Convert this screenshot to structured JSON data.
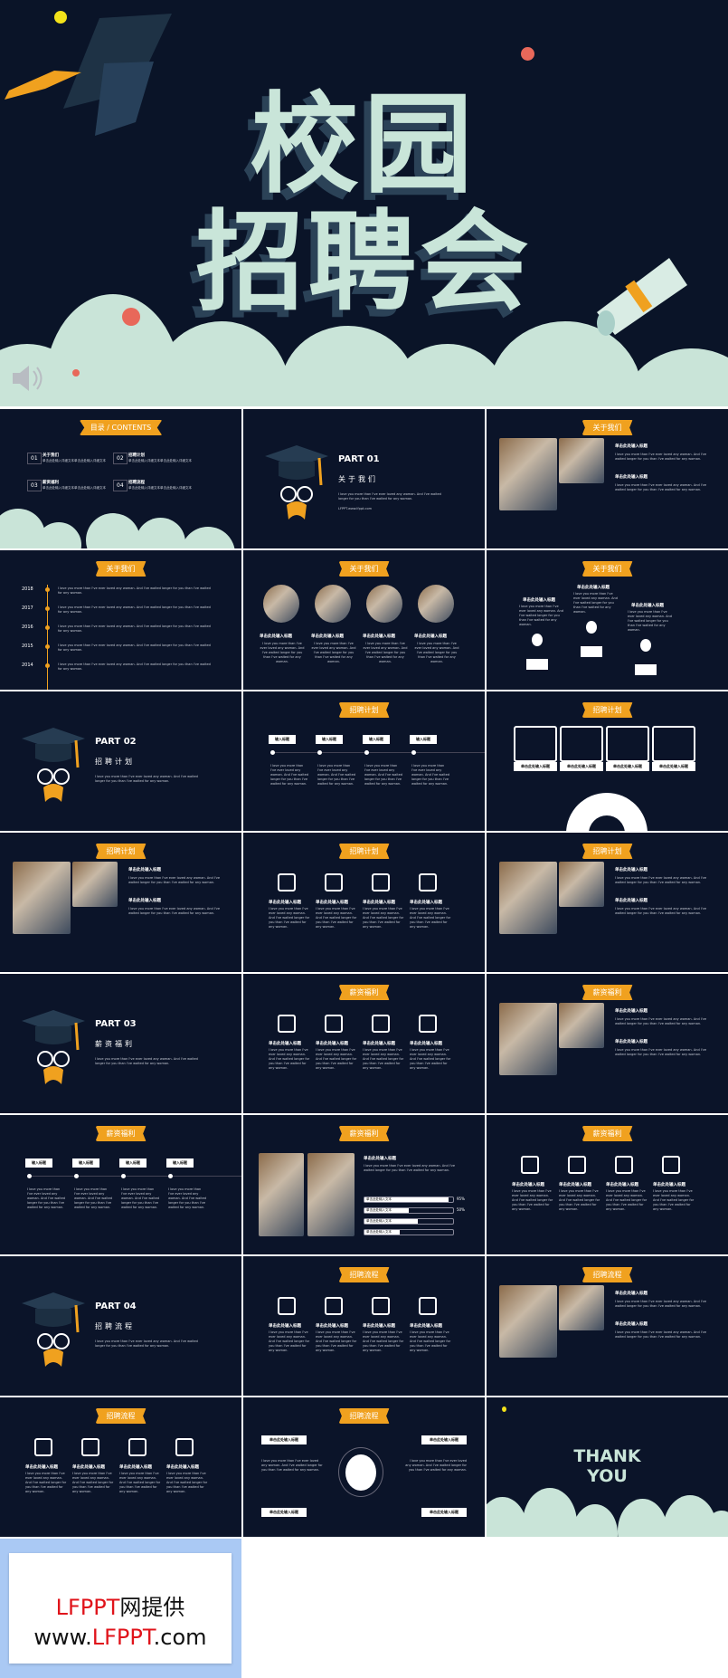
{
  "hero": {
    "title_line1": "校园",
    "title_line2": "招聘会",
    "icons": [
      "graduation-cap-icon",
      "diploma-scroll-icon",
      "speaker-icon"
    ],
    "colors": {
      "bg": "#0a1428",
      "title": "#c9e5d9",
      "cloud": "#c9e4d8",
      "accent": "#f0a11f"
    }
  },
  "common": {
    "heading": "单击此处输入标题",
    "body": "I love you more than I've ever loved any woman. And I've waited longer for you than I've waited for any woman.",
    "input_title": "输入标题",
    "input_text": "单击此处输入文本"
  },
  "slides": [
    {
      "kind": "contents",
      "ribbon": "目录 / CONTENTS",
      "items": [
        {
          "no": "01",
          "label": "关于我们"
        },
        {
          "no": "02",
          "label": "招聘计划"
        },
        {
          "no": "03",
          "label": "薪资福利"
        },
        {
          "no": "04",
          "label": "招聘流程"
        }
      ],
      "item_sub": "单击此处输入详细文本单击此处输入详细文本"
    },
    {
      "kind": "part",
      "part": "PART 01",
      "title": "关于我们",
      "url": "LFPPT.www.lfppt.com"
    },
    {
      "kind": "photo-text",
      "ribbon": "关于我们"
    },
    {
      "kind": "timeline",
      "ribbon": "关于我们",
      "years": [
        "2018",
        "2017",
        "2016",
        "2015",
        "2014"
      ]
    },
    {
      "kind": "circles",
      "ribbon": "关于我们"
    },
    {
      "kind": "arrows",
      "ribbon": "关于我们"
    },
    {
      "kind": "part",
      "part": "PART 02",
      "title": "招聘计划"
    },
    {
      "kind": "steps",
      "ribbon": "招聘计划"
    },
    {
      "kind": "cards",
      "ribbon": "招聘计划"
    },
    {
      "kind": "photo-text",
      "ribbon": "招聘计划"
    },
    {
      "kind": "icons",
      "ribbon": "招聘计划"
    },
    {
      "kind": "photo-text",
      "ribbon": "招聘计划"
    },
    {
      "kind": "part",
      "part": "PART 03",
      "title": "薪资福利"
    },
    {
      "kind": "icons",
      "ribbon": "薪资福利"
    },
    {
      "kind": "photo-text",
      "ribbon": "薪资福利"
    },
    {
      "kind": "steps",
      "ribbon": "薪资福利"
    },
    {
      "kind": "bars",
      "ribbon": "薪资福利",
      "bars": [
        95,
        50,
        60,
        40
      ],
      "labels": [
        "95%",
        "50%"
      ]
    },
    {
      "kind": "icons",
      "ribbon": "薪资福利"
    },
    {
      "kind": "part",
      "part": "PART 04",
      "title": "招聘流程"
    },
    {
      "kind": "icons",
      "ribbon": "招聘流程"
    },
    {
      "kind": "photo-text",
      "ribbon": "招聘流程"
    },
    {
      "kind": "icons",
      "ribbon": "招聘流程"
    },
    {
      "kind": "globe",
      "ribbon": "招聘流程"
    },
    {
      "kind": "thanks",
      "line1": "THANK",
      "line2": "YOU"
    }
  ],
  "watermark": {
    "line1_brand": "LFPPT",
    "line1_rest": "网提供",
    "line2_pre": "www.",
    "line2_brand": "LFPPT",
    "line2_post": ".com",
    "colors": {
      "brand": "#e0141b",
      "frame": "#aac9f4"
    }
  }
}
